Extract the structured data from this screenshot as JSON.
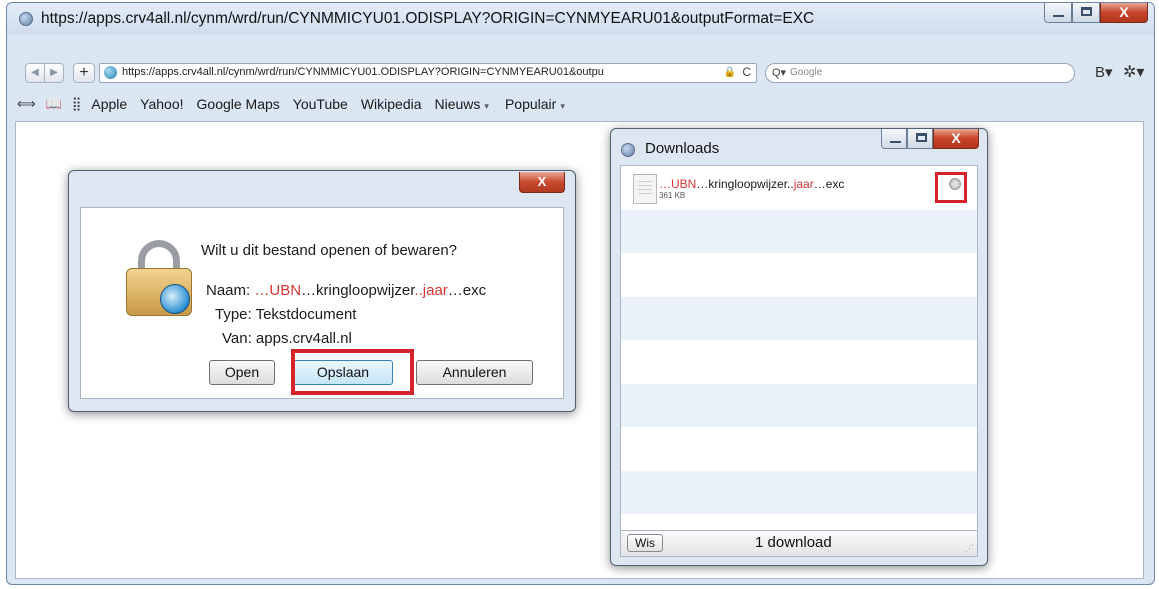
{
  "window": {
    "title": "https://apps.crv4all.nl/cynm/wrd/run/CYNMMICYU01.ODISPLAY?ORIGIN=CYNMYEARU01&outputFormat=EXC",
    "close_glyph": "X"
  },
  "toolbar": {
    "back_glyph": "◀",
    "forward_glyph": "▶",
    "add_glyph": "+",
    "url": "https://apps.crv4all.nl/cynm/wrd/run/CYNMMICYU01.ODISPLAY?ORIGIN=CYNMYEARU01&outpu",
    "lock_glyph": "🔒",
    "reload_glyph": "C",
    "search_glyph": "Q▾",
    "search_placeholder": "Google",
    "page_menu_glyph": "B▾",
    "gear_glyph": "✲▾"
  },
  "bookmarks": {
    "reading_glyph": "⟺",
    "book_glyph": "📖",
    "grid_glyph": "⣿",
    "items": [
      "Apple",
      "Yahoo!",
      "Google Maps",
      "YouTube",
      "Wikipedia"
    ],
    "dropdowns": [
      "Nieuws",
      "Populair"
    ],
    "caret": "▾"
  },
  "dialog": {
    "close_glyph": "X",
    "question": "Wilt u dit bestand openen of bewaren?",
    "naam_label": "Naam:",
    "file_ellipsis1": "…",
    "file_ubn": "UBN",
    "file_ellipsis2": "…",
    "file_mid": "kringloopwijzer",
    "file_ellipsis3": "..",
    "file_jaar": "jaar",
    "file_tail": "…exc",
    "type_line": "Type: Tekstdocument",
    "van_line": "Van: apps.crv4all.nl",
    "open_label": "Open",
    "save_label": "Opslaan",
    "cancel_label": "Annuleren"
  },
  "downloads": {
    "title": "Downloads",
    "close_glyph": "X",
    "item": {
      "ellipsis1": "…",
      "ubn": "UBN",
      "mid": "…kringloopwijzer..",
      "jaar": "jaar",
      "tail": "…exc",
      "size": "361 KB"
    },
    "clear_button": "Wis",
    "count": "1 download",
    "grip": "⋰"
  },
  "colors": {
    "highlight": "#d7242b",
    "filename_red": "#d93434"
  }
}
